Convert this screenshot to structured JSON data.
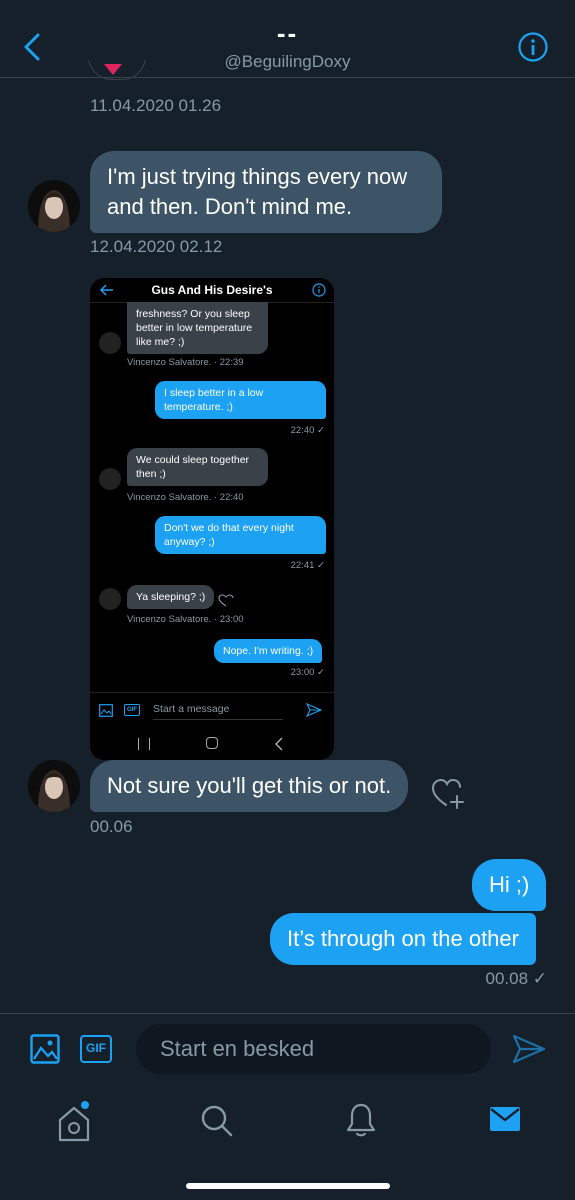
{
  "header": {
    "title": "--",
    "handle": "@BeguilingDoxy"
  },
  "messages": {
    "ts1": "11.04.2020 01.26",
    "m1": "I'm just trying things every now and then. Don't mind me.",
    "ts2": "12.04.2020 02.12",
    "m2": "Not sure you'll get this or not.",
    "ts3": "00.06",
    "m3": "Hi ;)",
    "m4": "It’s through on the other",
    "ts4": "00.08 ✓"
  },
  "embedded": {
    "title": "Gus And His Desire's",
    "m1": "freshness? Or you sleep better in low temperature like me? ;)",
    "meta1": "Vincenzo Salvatore. · 22:39",
    "m2": "I sleep better in a low temperature. ;)",
    "meta2": "22:40 ✓",
    "m3": "We could sleep together then ;)",
    "meta3": "Vincenzo Salvatore. · 22:40",
    "m4": "Don't we do that every night anyway? ;)",
    "meta4": "22:41 ✓",
    "m5": "Ya sleeping? ;)",
    "meta5": "Vincenzo Salvatore. · 23:00",
    "m6": "Nope. I'm writing. ;)",
    "meta6": "23:00 ✓",
    "gif": "GIF",
    "placeholder": "Start a message"
  },
  "compose": {
    "gif": "GIF",
    "placeholder": "Start en besked"
  },
  "colors": {
    "background": "#15202b",
    "accent": "#1da1f2",
    "incoming": "#3d5466",
    "secondary_text": "#8899a6"
  }
}
